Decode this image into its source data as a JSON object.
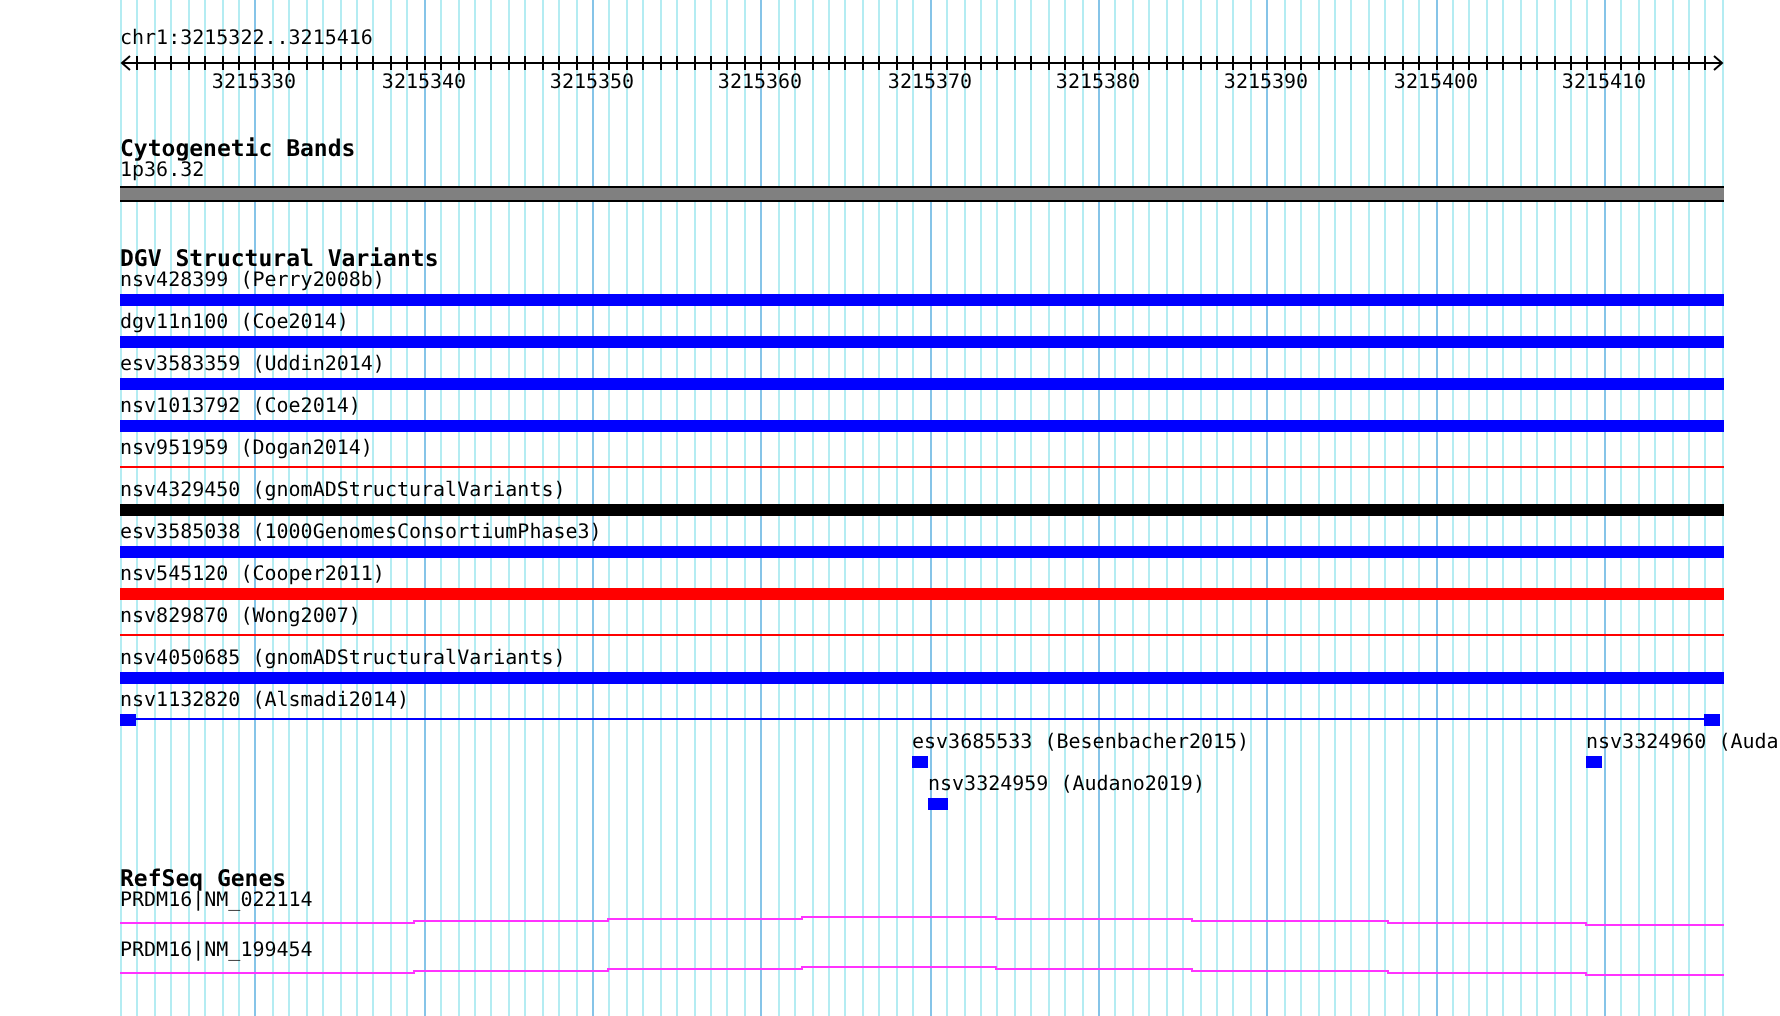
{
  "location": "chr1:3215322..3215416",
  "ruler": {
    "labels": [
      "3215330",
      "3215340",
      "3215350",
      "3215360",
      "3215370",
      "3215380",
      "3215390",
      "3215400",
      "3215410"
    ]
  },
  "cytogenetic_bands": {
    "title": "Cytogenetic Bands",
    "features": [
      {
        "label": "1p36.32",
        "kind": "band"
      }
    ]
  },
  "dgv": {
    "title": "DGV Structural Variants",
    "features": [
      {
        "label": "nsv428399 (Perry2008b)",
        "kind": "bar",
        "color": "#0000ff"
      },
      {
        "label": "dgv11n100 (Coe2014)",
        "kind": "bar",
        "color": "#0000ff"
      },
      {
        "label": "esv3583359 (Uddin2014)",
        "kind": "bar",
        "color": "#0000ff"
      },
      {
        "label": "nsv1013792 (Coe2014)",
        "kind": "bar",
        "color": "#0000ff"
      },
      {
        "label": "nsv951959 (Dogan2014)",
        "kind": "line",
        "color": "#ff0000"
      },
      {
        "label": "nsv4329450 (gnomADStructuralVariants)",
        "kind": "bar",
        "color": "#000000"
      },
      {
        "label": "esv3585038 (1000GenomesConsortiumPhase3)",
        "kind": "bar",
        "color": "#0000ff"
      },
      {
        "label": "nsv545120 (Cooper2011)",
        "kind": "bar",
        "color": "#ff0000"
      },
      {
        "label": "nsv829870 (Wong2007)",
        "kind": "line",
        "color": "#ff0000"
      },
      {
        "label": "nsv4050685 (gnomADStructuralVariants)",
        "kind": "bar",
        "color": "#0000ff"
      },
      {
        "label": "nsv1132820 (Alsmadi2014)",
        "kind": "split",
        "color": "#0000ff"
      }
    ],
    "lanes": [
      {
        "features": [
          {
            "label": "esv3685533 (Besenbacher2015)",
            "color": "#0000ff"
          },
          {
            "label": "nsv3324960 (Auda",
            "color": "#0000ff"
          }
        ]
      },
      {
        "features": [
          {
            "label": "nsv3324959 (Audano2019)",
            "color": "#0000ff"
          }
        ]
      }
    ]
  },
  "refseq": {
    "title": "RefSeq Genes",
    "transcripts": [
      {
        "label": "PRDM16|NM_022114"
      },
      {
        "label": "PRDM16|NM_199454"
      }
    ]
  }
}
